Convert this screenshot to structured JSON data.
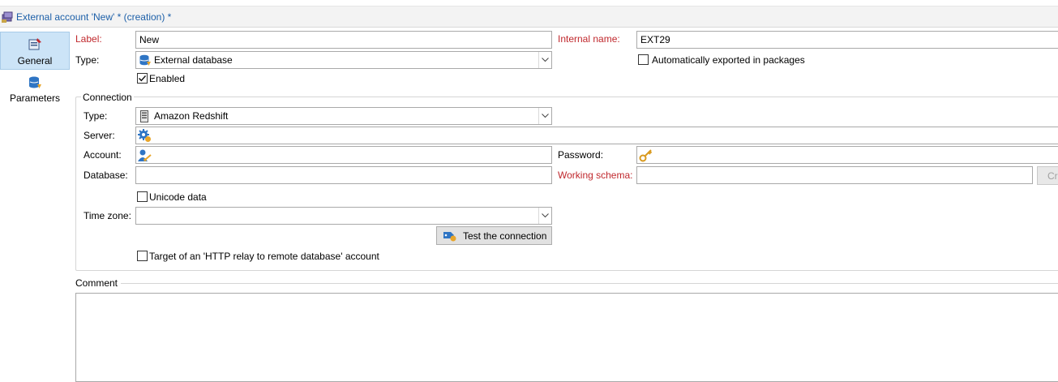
{
  "window": {
    "title": "External account 'New' * (creation) *"
  },
  "sidebar": {
    "items": [
      {
        "label": "General",
        "icon": "general-settings-icon",
        "active": true
      },
      {
        "label": "Parameters",
        "icon": "database-parameters-icon",
        "active": false
      }
    ]
  },
  "form": {
    "label": {
      "label": "Label:",
      "value": "New"
    },
    "internal_name": {
      "label": "Internal name:",
      "value": "EXT29"
    },
    "type": {
      "label": "Type:",
      "value": "External database",
      "icon": "database-icon"
    },
    "auto_export": {
      "label": "Automatically exported in packages",
      "checked": false
    },
    "enabled": {
      "label": "Enabled",
      "checked": true
    }
  },
  "connection": {
    "legend": "Connection",
    "type": {
      "label": "Type:",
      "value": "Amazon Redshift",
      "icon": "server-icon"
    },
    "server": {
      "label": "Server:",
      "value": "",
      "icon": "server-gear-icon"
    },
    "account": {
      "label": "Account:",
      "value": "",
      "icon": "user-key-icon"
    },
    "password": {
      "label": "Password:",
      "value": "",
      "icon": "key-icon"
    },
    "database": {
      "label": "Database:",
      "value": ""
    },
    "working_schema": {
      "label": "Working schema:",
      "value": ""
    },
    "create_button": {
      "label": "Cr"
    },
    "unicode": {
      "label": "Unicode data",
      "checked": false
    },
    "timezone": {
      "label": "Time zone:",
      "value": ""
    },
    "test_button": {
      "label": "Test the connection",
      "icon": "test-connection-icon"
    },
    "http_relay": {
      "label": "Target of an 'HTTP relay to remote database' account",
      "checked": false
    }
  },
  "comment": {
    "legend": "Comment",
    "value": ""
  },
  "colors": {
    "accent": "#1c5fa8",
    "required_label": "#c0282d",
    "selected_bg": "#cce4f7"
  }
}
